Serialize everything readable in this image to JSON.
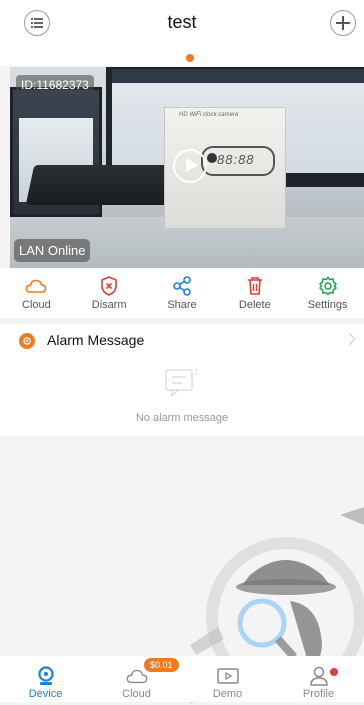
{
  "header": {
    "title": "test",
    "menu_icon": "list-icon",
    "add_icon": "plus-icon"
  },
  "camera": {
    "id_label": "ID:11682373",
    "status": "LAN Online",
    "clock_label": "HD WiFi clock camera",
    "clock_digits": "88:88"
  },
  "actions": [
    {
      "label": "Cloud",
      "icon": "cloud-icon",
      "color": "#f07b1d"
    },
    {
      "label": "Disarm",
      "icon": "shield-x-icon",
      "color": "#e43b3b"
    },
    {
      "label": "Share",
      "icon": "share-icon",
      "color": "#1b7fe0"
    },
    {
      "label": "Delete",
      "icon": "trash-icon",
      "color": "#e43b3b"
    },
    {
      "label": "Settings",
      "icon": "gear-icon",
      "color": "#16a34a"
    }
  ],
  "alarm": {
    "title": "Alarm Message",
    "empty_text": "No alarm message"
  },
  "tabs": [
    {
      "label": "Device",
      "icon": "camera-icon",
      "active": true
    },
    {
      "label": "Cloud",
      "icon": "cloud-icon",
      "badge": "$0.01"
    },
    {
      "label": "Demo",
      "icon": "play-video-icon"
    },
    {
      "label": "Profile",
      "icon": "user-icon",
      "dot": true
    }
  ],
  "colors": {
    "accent": "#f07b1d",
    "active_tab": "#1b7fe0",
    "danger": "#e43b3b",
    "success": "#16a34a"
  }
}
